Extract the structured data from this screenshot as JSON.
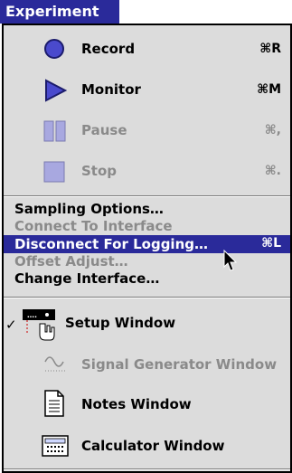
{
  "menu_title": "Experiment",
  "icon_group": [
    {
      "label": "Record",
      "shortcut": "⌘R"
    },
    {
      "label": "Monitor",
      "shortcut": "⌘M"
    },
    {
      "label": "Pause",
      "shortcut": "⌘,"
    },
    {
      "label": "Stop",
      "shortcut": "⌘."
    }
  ],
  "text_group": [
    {
      "label": "Sampling Options…"
    },
    {
      "label": "Connect To Interface"
    },
    {
      "label": "Disconnect For Logging…",
      "shortcut": "⌘L"
    },
    {
      "label": "Offset Adjust…"
    },
    {
      "label": "Change Interface…"
    }
  ],
  "windows_group": [
    {
      "label": "Setup Window",
      "icon_text": "…."
    },
    {
      "label": "Signal Generator Window"
    },
    {
      "label": "Notes Window"
    },
    {
      "label": "Calculator Window"
    }
  ],
  "colors": {
    "highlight": "#2a2a9a",
    "menu_bg": "#dcdcdc",
    "disabled": "#8a8a8a",
    "record_icon": "#4a4acd"
  }
}
